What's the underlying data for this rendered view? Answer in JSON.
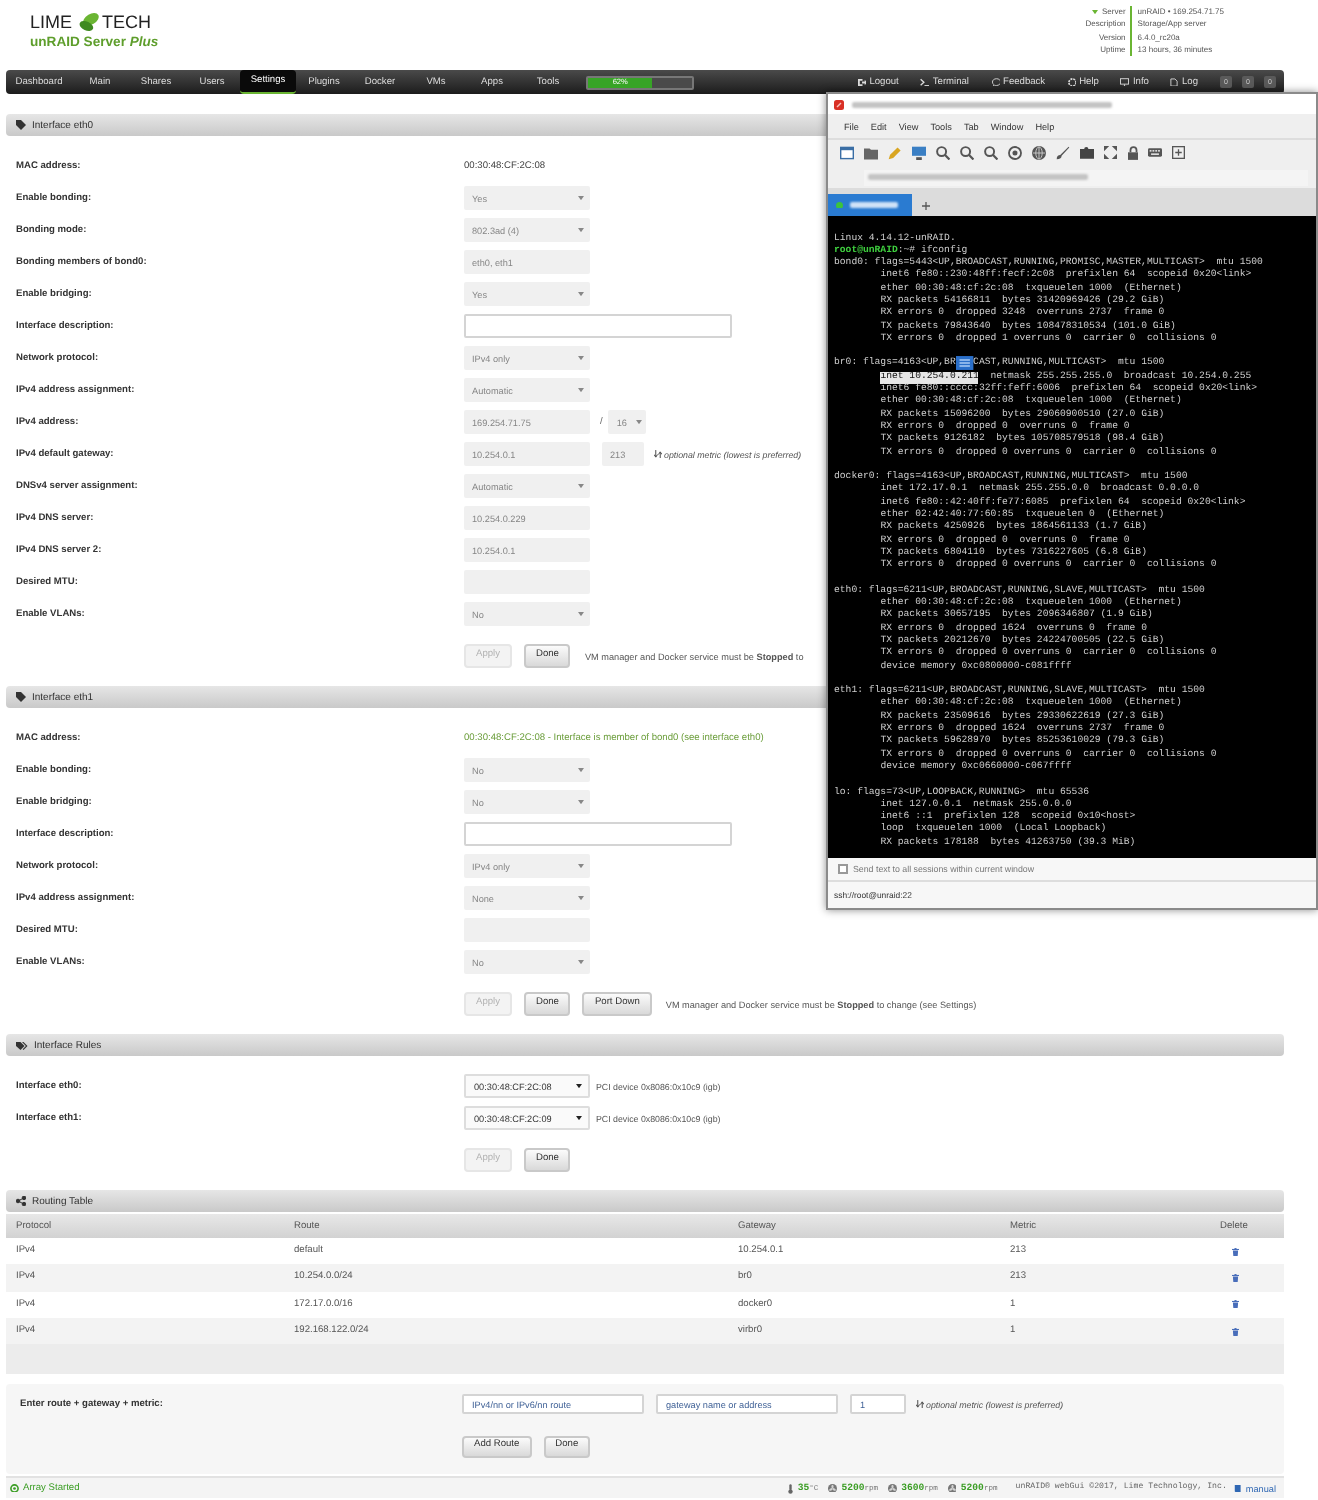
{
  "header": {
    "logo": {
      "left": "LIME",
      "right": "TECH"
    },
    "product": "unRAID Server *Plus*",
    "server_info": [
      {
        "label": "Server",
        "value": "unRAID • 169.254.71.75",
        "expandable": true
      },
      {
        "label": "Description",
        "value": "Storage/App server",
        "expandable": false
      },
      {
        "label": "Version",
        "value": "6.4.0_rc20a",
        "expandable": false
      },
      {
        "label": "Uptime",
        "value": "13 hours, 36 minutes",
        "expandable": false
      }
    ]
  },
  "nav": {
    "tabs": [
      {
        "label": "Dashboard",
        "selected": false
      },
      {
        "label": "Main",
        "selected": false
      },
      {
        "label": "Shares",
        "selected": false
      },
      {
        "label": "Users",
        "selected": false
      },
      {
        "label": "Settings",
        "selected": true
      },
      {
        "label": "Plugins",
        "selected": false
      },
      {
        "label": "Docker",
        "selected": false
      },
      {
        "label": "VMs",
        "selected": false
      },
      {
        "label": "Apps",
        "selected": false
      },
      {
        "label": "Tools",
        "selected": false
      }
    ],
    "usage": {
      "level": 0.62,
      "reading": "62%"
    },
    "links": [
      {
        "kind": "logout",
        "label": "Logout"
      },
      {
        "kind": "terminal",
        "label": "Terminal"
      },
      {
        "kind": "feedback",
        "label": "Feedback"
      },
      {
        "kind": "help",
        "label": "Help"
      },
      {
        "kind": "info",
        "label": "Info"
      },
      {
        "kind": "log",
        "label": "Log"
      }
    ],
    "counters": [
      "0",
      "0",
      "0"
    ]
  },
  "sections": [
    {
      "kind": "interface",
      "title": "Interface eth0",
      "rows": [
        {
          "label": "MAC address:",
          "kind": "text",
          "value": "00:30:48:CF:2C:08"
        },
        {
          "label": "Enable bonding:",
          "kind": "select",
          "value": "Yes",
          "disabled": true
        },
        {
          "label": "Bonding mode:",
          "kind": "select",
          "value": "802.3ad (4)",
          "disabled": true
        },
        {
          "label": "Bonding members of bond0:",
          "kind": "input",
          "value": "eth0, eth1",
          "disabled": true
        },
        {
          "label": "Enable bridging:",
          "kind": "select",
          "value": "Yes",
          "disabled": true
        },
        {
          "label": "Interface description:",
          "kind": "wide-input",
          "disabled": false
        },
        {
          "label": "Network protocol:",
          "kind": "select",
          "value": "IPv4 only",
          "disabled": true
        },
        {
          "label": "IPv4 address assignment:",
          "kind": "select",
          "value": "Automatic",
          "disabled": true
        },
        {
          "label": "IPv4 address:",
          "kind": "address",
          "value": "169.254.71.75",
          "separator": "/",
          "mask": "16",
          "disabled": true
        },
        {
          "label": "IPv4 default gateway:",
          "kind": "gateway",
          "value": "10.254.0.1",
          "metric": "213",
          "note": "optional metric (lowest is preferred)",
          "disabled": true
        },
        {
          "label": "DNSv4 server assignment:",
          "kind": "select",
          "value": "Automatic",
          "disabled": true
        },
        {
          "label": "IPv4 DNS server:",
          "kind": "input",
          "value": "10.254.0.229",
          "disabled": true
        },
        {
          "label": "IPv4 DNS server 2:",
          "kind": "input",
          "value": "10.254.0.1",
          "disabled": true
        },
        {
          "label": "Desired MTU:",
          "kind": "input",
          "disabled": true
        },
        {
          "label": "Enable VLANs:",
          "kind": "select",
          "value": "No",
          "disabled": true
        }
      ],
      "buttons": [
        {
          "label": "Apply",
          "disabled": true
        },
        {
          "label": "Done",
          "disabled": false
        }
      ],
      "message": "VM manager and Docker service must be **Stopped** to"
    },
    {
      "kind": "interface",
      "title": "Interface eth1",
      "rows": [
        {
          "label": "MAC address:",
          "kind": "notice",
          "value": "00:30:48:CF:2C:08 - Interface is member of bond0 (see interface eth0)"
        },
        {
          "label": "Enable bonding:",
          "kind": "select",
          "value": "No",
          "disabled": true
        },
        {
          "label": "Enable bridging:",
          "kind": "select",
          "value": "No",
          "disabled": true
        },
        {
          "label": "Interface description:",
          "kind": "wide-input",
          "disabled": false
        },
        {
          "label": "Network protocol:",
          "kind": "select",
          "value": "IPv4 only",
          "disabled": true
        },
        {
          "label": "IPv4 address assignment:",
          "kind": "select",
          "value": "None",
          "disabled": true
        },
        {
          "label": "Desired MTU:",
          "kind": "input",
          "disabled": true
        },
        {
          "label": "Enable VLANs:",
          "kind": "select",
          "value": "No",
          "disabled": true
        }
      ],
      "buttons": [
        {
          "label": "Apply",
          "disabled": true
        },
        {
          "label": "Done",
          "disabled": false
        },
        {
          "label": "Port Down",
          "disabled": false
        }
      ],
      "message": "VM manager and Docker service must be **Stopped** to change (see Settings)"
    },
    {
      "kind": "rules",
      "title": "Interface Rules",
      "rows": [
        {
          "label": "Interface eth0:",
          "kind": "device-select",
          "value": "00:30:48:CF:2C:08",
          "note": "PCI device 0x8086:0x10c9 (igb)",
          "disabled": false
        },
        {
          "label": "Interface eth1:",
          "kind": "device-select",
          "value": "00:30:48:CF:2C:09",
          "note": "PCI device 0x8086:0x10c9 (igb)",
          "disabled": false
        }
      ],
      "buttons": [
        {
          "label": "Apply",
          "disabled": true
        },
        {
          "label": "Done",
          "disabled": false
        }
      ]
    }
  ],
  "routing_table": {
    "title": "Routing Table",
    "columns": [
      "Protocol",
      "Route",
      "Gateway",
      "Metric",
      "Delete"
    ],
    "rows": [
      [
        "IPv4",
        "default",
        "10.254.0.1",
        "213"
      ],
      [
        "IPv4",
        "10.254.0.0/24",
        "br0",
        "213"
      ],
      [
        "IPv4",
        "172.17.0.0/16",
        "docker0",
        "1"
      ],
      [
        "IPv4",
        "192.168.122.0/24",
        "virbr0",
        "1"
      ]
    ],
    "add_route": {
      "label": "Enter route + gateway + metric:",
      "route_placeholder": "IPv4/nn or IPv6/nn route",
      "gateway_placeholder": "gateway name or address",
      "metric": "1",
      "note": "optional metric (lowest is preferred)",
      "buttons": [
        "Add Route",
        "Done"
      ]
    }
  },
  "footer": {
    "array_status": "Array Started",
    "temperature": {
      "value": "35",
      "unit": "°C"
    },
    "fans": [
      {
        "value": "5200",
        "unit": "rpm"
      },
      {
        "value": "3600",
        "unit": "rpm"
      },
      {
        "value": "5200",
        "unit": "rpm"
      }
    ],
    "copyright": "unRAID® webGui ©2017, Lime Technology, Inc.",
    "manual": "manual"
  },
  "terminal": {
    "menu": [
      "File",
      "Edit",
      "View",
      "Tools",
      "Tab",
      "Window",
      "Help"
    ],
    "intro": "Linux 4.14.12-unRAID.",
    "prompt": {
      "user_host": "root@unRAID",
      "command": ":~# ifconfig"
    },
    "interfaces": [
      {
        "header": "bond0: flags=5443<UP,BROADCAST,RUNNING,PROMISC,MASTER,MULTICAST>  mtu 1500",
        "lines": [
          "inet6 fe80::230:48ff:fecf:2c08  prefixlen 64  scopeid 0x20<link>",
          "ether 00:30:48:cf:2c:08  txqueuelen 1000  (Ethernet)",
          "RX packets 54166811  bytes 31420969426 (29.2 GiB)",
          "RX errors 0  dropped 3248  overruns 2737  frame 0",
          "TX packets 79843640  bytes 108478310534 (101.0 GiB)",
          "TX errors 0  dropped 1 overruns 0  carrier 0  collisions 0"
        ]
      },
      {
        "header": "br0: flags=4163<UP,BR",
        "header_after_icon": "CAST,RUNNING,MULTICAST>  mtu 1500",
        "lines": [
          {
            "highlighted": "inet 10.254.0.211",
            "rest": "  netmask 255.255.255.0  broadcast 10.254.0.255"
          },
          "inet6 fe80::cccc:32ff:feff:6006  prefixlen 64  scopeid 0x20<link>",
          "ether 00:30:48:cf:2c:08  txqueuelen 1000  (Ethernet)",
          "RX packets 15096200  bytes 29060900510 (27.0 GiB)",
          "RX errors 0  dropped 0  overruns 0  frame 0",
          "TX packets 9126182  bytes 105708579518 (98.4 GiB)",
          "TX errors 0  dropped 0 overruns 0  carrier 0  collisions 0"
        ]
      },
      {
        "header": "docker0: flags=4163<UP,BROADCAST,RUNNING,MULTICAST>  mtu 1500",
        "lines": [
          "inet 172.17.0.1  netmask 255.255.0.0  broadcast 0.0.0.0",
          "inet6 fe80::42:40ff:fe77:6085  prefixlen 64  scopeid 0x20<link>",
          "ether 02:42:40:77:60:85  txqueuelen 0  (Ethernet)",
          "RX packets 4250926  bytes 1864561133 (1.7 GiB)",
          "RX errors 0  dropped 0  overruns 0  frame 0",
          "TX packets 6804110  bytes 7316227605 (6.8 GiB)",
          "TX errors 0  dropped 0 overruns 0  carrier 0  collisions 0"
        ]
      },
      {
        "header": "eth0: flags=6211<UP,BROADCAST,RUNNING,SLAVE,MULTICAST>  mtu 1500",
        "lines": [
          "ether 00:30:48:cf:2c:08  txqueuelen 1000  (Ethernet)",
          "RX packets 30657195  bytes 2096346807 (1.9 GiB)",
          "RX errors 0  dropped 1624  overruns 0  frame 0",
          "TX packets 20212670  bytes 24224700505 (22.5 GiB)",
          "TX errors 0  dropped 0 overruns 0  carrier 0  collisions 0",
          "device memory 0xc0800000-c081ffff"
        ]
      },
      {
        "header": "eth1: flags=6211<UP,BROADCAST,RUNNING,SLAVE,MULTICAST>  mtu 1500",
        "lines": [
          "ether 00:30:48:cf:2c:08  txqueuelen 1000  (Ethernet)",
          "RX packets 23509616  bytes 29330622619 (27.3 GiB)",
          "RX errors 0  dropped 1624  overruns 2737  frame 0",
          "TX packets 59628970  bytes 85253610029 (79.3 GiB)",
          "TX errors 0  dropped 0 overruns 0  carrier 0  collisions 0",
          "device memory 0xc0660000-c067ffff"
        ]
      },
      {
        "header": "lo: flags=73<UP,LOOPBACK,RUNNING>  mtu 65536",
        "lines": [
          "inet 127.0.0.1  netmask 255.0.0.0",
          "inet6 ::1  prefixlen 128  scopeid 0x10<host>",
          "loop  txqueuelen 1000  (Local Loopback)",
          "RX packets 178188  bytes 41263750 (39.3 MiB)"
        ]
      }
    ],
    "broadcast": {
      "label": "Send text to all sessions within current window",
      "checked": false
    },
    "status": "ssh://root@unraid:22"
  }
}
